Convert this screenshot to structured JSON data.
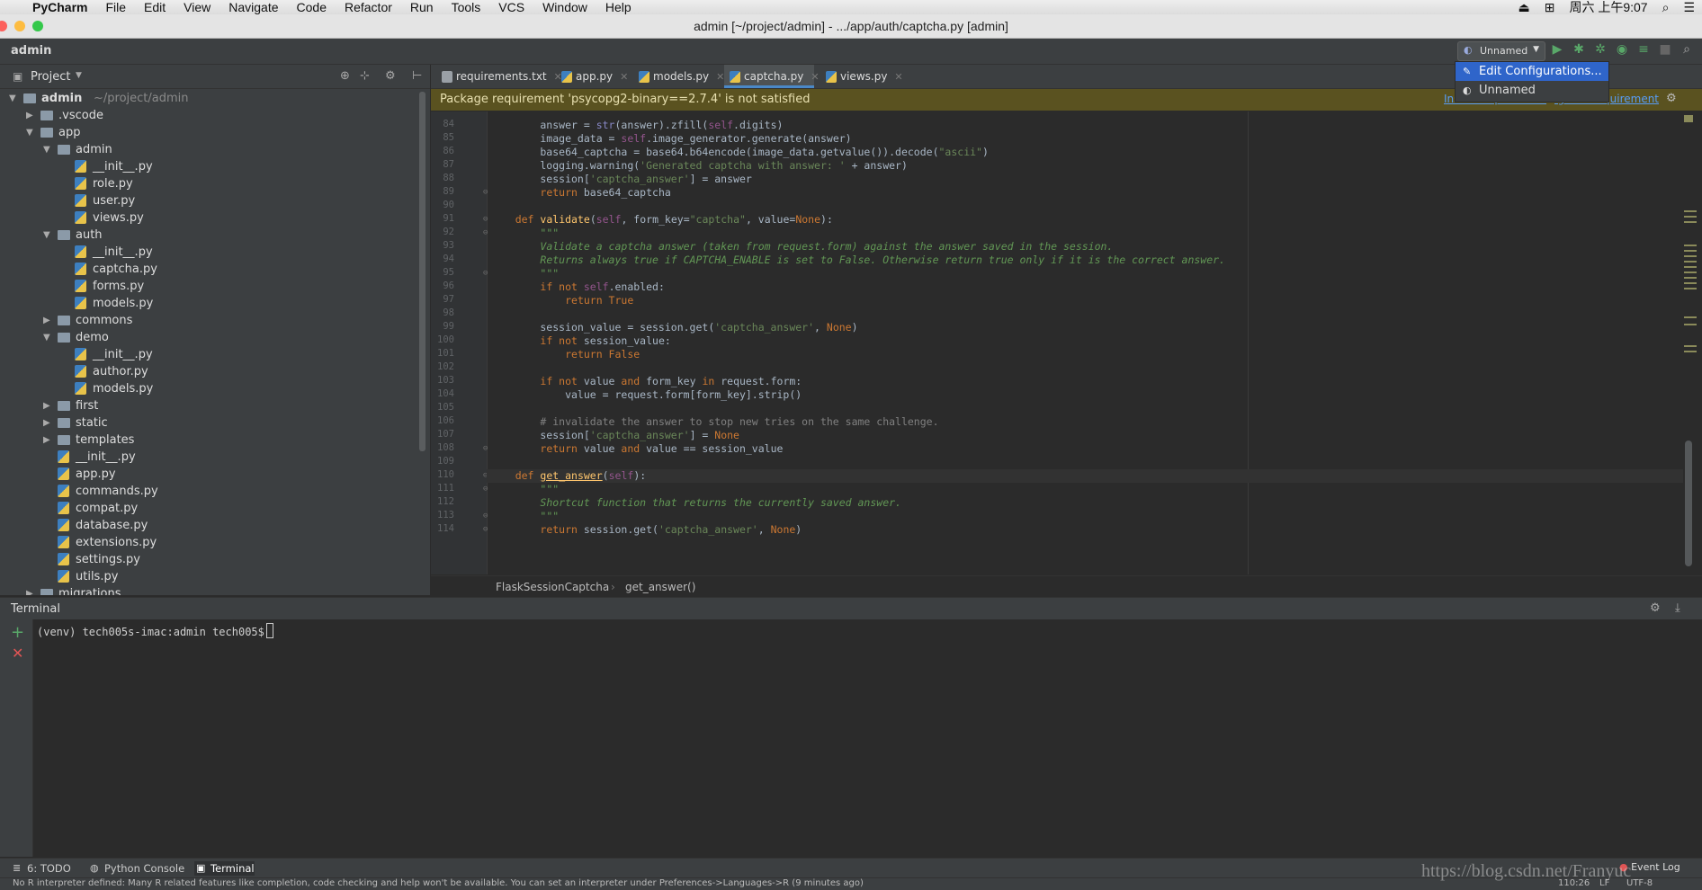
{
  "menubar": {
    "app": "PyCharm",
    "items": [
      "File",
      "Edit",
      "View",
      "Navigate",
      "Code",
      "Refactor",
      "Run",
      "Tools",
      "VCS",
      "Window",
      "Help"
    ],
    "clock": "周六 上午9:07"
  },
  "window": {
    "title": "admin [~/project/admin] - .../app/auth/captcha.py [admin]"
  },
  "navbar": {
    "crumb": "admin",
    "run_config": "Unnamed"
  },
  "run_dropdown": {
    "items": [
      "Edit Configurations...",
      "Unnamed"
    ]
  },
  "project_panel": {
    "title": "Project",
    "tree": [
      {
        "name": "admin",
        "hint": "~/project/admin",
        "type": "folder",
        "depth": 0,
        "expanded": true,
        "bold": true
      },
      {
        "name": ".vscode",
        "type": "folder",
        "depth": 1,
        "expanded": false
      },
      {
        "name": "app",
        "type": "folder",
        "depth": 1,
        "expanded": true
      },
      {
        "name": "admin",
        "type": "folder",
        "depth": 2,
        "expanded": true
      },
      {
        "name": "__init__.py",
        "type": "py",
        "depth": 3
      },
      {
        "name": "role.py",
        "type": "py",
        "depth": 3
      },
      {
        "name": "user.py",
        "type": "py",
        "depth": 3
      },
      {
        "name": "views.py",
        "type": "py",
        "depth": 3
      },
      {
        "name": "auth",
        "type": "folder",
        "depth": 2,
        "expanded": true
      },
      {
        "name": "__init__.py",
        "type": "py",
        "depth": 3
      },
      {
        "name": "captcha.py",
        "type": "py",
        "depth": 3
      },
      {
        "name": "forms.py",
        "type": "py",
        "depth": 3
      },
      {
        "name": "models.py",
        "type": "py",
        "depth": 3
      },
      {
        "name": "commons",
        "type": "folder",
        "depth": 2,
        "expanded": false
      },
      {
        "name": "demo",
        "type": "folder",
        "depth": 2,
        "expanded": true
      },
      {
        "name": "__init__.py",
        "type": "py",
        "depth": 3
      },
      {
        "name": "author.py",
        "type": "py",
        "depth": 3
      },
      {
        "name": "models.py",
        "type": "py",
        "depth": 3
      },
      {
        "name": "first",
        "type": "folder",
        "depth": 2,
        "expanded": false
      },
      {
        "name": "static",
        "type": "folder",
        "depth": 2,
        "expanded": false
      },
      {
        "name": "templates",
        "type": "folder",
        "depth": 2,
        "expanded": false
      },
      {
        "name": "__init__.py",
        "type": "py",
        "depth": 2
      },
      {
        "name": "app.py",
        "type": "py",
        "depth": 2
      },
      {
        "name": "commands.py",
        "type": "py",
        "depth": 2
      },
      {
        "name": "compat.py",
        "type": "py",
        "depth": 2
      },
      {
        "name": "database.py",
        "type": "py",
        "depth": 2
      },
      {
        "name": "extensions.py",
        "type": "py",
        "depth": 2
      },
      {
        "name": "settings.py",
        "type": "py",
        "depth": 2
      },
      {
        "name": "utils.py",
        "type": "py",
        "depth": 2
      },
      {
        "name": "migrations",
        "type": "folder",
        "depth": 1,
        "expanded": false
      }
    ]
  },
  "editor_tabs": [
    {
      "label": "requirements.txt",
      "kind": "txt",
      "active": false
    },
    {
      "label": "app.py",
      "kind": "py",
      "active": false
    },
    {
      "label": "models.py",
      "kind": "py",
      "active": false
    },
    {
      "label": "captcha.py",
      "kind": "py",
      "active": true
    },
    {
      "label": "views.py",
      "kind": "py",
      "active": false
    }
  ],
  "banner": {
    "message": "Package requirement 'psycopg2-binary==2.7.4' is not satisfied",
    "install": "Install requirement",
    "ignore": "Ignore requirement"
  },
  "code_lines": [
    {
      "n": "84",
      "html": "        answer = <span class=\"bi\">str</span>(answer).zfill(<span class=\"sf\">self</span>.digits)"
    },
    {
      "n": "85",
      "html": "        image_data = <span class=\"sf\">self</span>.image_generator.generate(answer)"
    },
    {
      "n": "86",
      "html": "        base64_captcha = base64.b64encode(image_data.getvalue()).decode(<span class=\"str\">\"ascii\"</span>)"
    },
    {
      "n": "87",
      "html": "        logging.warning(<span class=\"str\">'Generated captcha with answer: '</span> + answer)"
    },
    {
      "n": "88",
      "html": "        session[<span class=\"str\">'captcha_answer'</span>] = answer"
    },
    {
      "n": "89",
      "html": "        <span class=\"kw\">return</span> base64_captcha"
    },
    {
      "n": "90",
      "html": ""
    },
    {
      "n": "91",
      "html": "    <span class=\"kw\">def</span> <span class=\"fn\">validate</span>(<span class=\"sf\">self</span>, form_key=<span class=\"str\">\"captcha\"</span>, value=<span class=\"kw\">None</span>):"
    },
    {
      "n": "92",
      "html": "        <span class=\"doc\">\"\"\"</span>"
    },
    {
      "n": "93",
      "html": "        <span class=\"doc\">Validate a captcha answer (taken from request.form) against the answer saved in the session.</span>"
    },
    {
      "n": "94",
      "html": "        <span class=\"doc\">Returns always true if CAPTCHA_ENABLE is set to False. Otherwise return true only if it is the correct answer.</span>"
    },
    {
      "n": "95",
      "html": "        <span class=\"doc\">\"\"\"</span>"
    },
    {
      "n": "96",
      "html": "        <span class=\"kw\">if not</span> <span class=\"sf\">self</span>.enabled:"
    },
    {
      "n": "97",
      "html": "            <span class=\"kw\">return True</span>"
    },
    {
      "n": "98",
      "html": ""
    },
    {
      "n": "99",
      "html": "        session_value = session.get(<span class=\"str\">'captcha_answer'</span>, <span class=\"kw\">None</span>)"
    },
    {
      "n": "100",
      "html": "        <span class=\"kw\">if not</span> session_value:"
    },
    {
      "n": "101",
      "html": "            <span class=\"kw\">return False</span>"
    },
    {
      "n": "102",
      "html": ""
    },
    {
      "n": "103",
      "html": "        <span class=\"kw\">if not</span> value <span class=\"kw\">and</span> form_key <span class=\"kw\">in</span> request.form:"
    },
    {
      "n": "104",
      "html": "            value = request.form[form_key].strip()"
    },
    {
      "n": "105",
      "html": ""
    },
    {
      "n": "106",
      "html": "        <span class=\"cm\"># invalidate the answer to stop new tries on the same challenge.</span>"
    },
    {
      "n": "107",
      "html": "        session[<span class=\"str\">'captcha_answer'</span>] = <span class=\"kw\">None</span>"
    },
    {
      "n": "108",
      "html": "        <span class=\"kw\">return</span> value <span class=\"kw\">and</span> value == session_value"
    },
    {
      "n": "109",
      "html": ""
    },
    {
      "n": "110",
      "html": "    <span class=\"kw\">def</span> <span class=\"fn\" style=\"text-decoration:underline\">get_answer</span>(<span class=\"sf\">self</span>):"
    },
    {
      "n": "111",
      "html": "        <span class=\"doc\">\"\"\"</span>"
    },
    {
      "n": "112",
      "html": "        <span class=\"doc\">Shortcut function that returns the currently saved answer.</span>"
    },
    {
      "n": "113",
      "html": "        <span class=\"doc\">\"\"\"</span>"
    },
    {
      "n": "114",
      "html": "        <span class=\"kw\">return</span> session.get(<span class=\"str\">'captcha_answer'</span>, <span class=\"kw\">None</span>)"
    }
  ],
  "breadcrumb": {
    "class": "FlaskSessionCaptcha",
    "method": "get_answer()"
  },
  "terminal": {
    "title": "Terminal",
    "prompt": "(venv) tech005s-imac:admin tech005$"
  },
  "toolwindows": [
    {
      "label": "6: TODO",
      "active": false
    },
    {
      "label": "Python Console",
      "active": false
    },
    {
      "label": "Terminal",
      "active": true
    }
  ],
  "statusbar": {
    "message": "No R interpreter defined: Many R related features like completion, code checking and help won't be available. You can set an interpreter under Preferences->Languages->R (9 minutes ago)",
    "position": "110:26",
    "line_sep": "LF",
    "encoding": "UTF-8",
    "event_log": "Event Log"
  },
  "watermark": "https://blog.csdn.net/Franyuc"
}
